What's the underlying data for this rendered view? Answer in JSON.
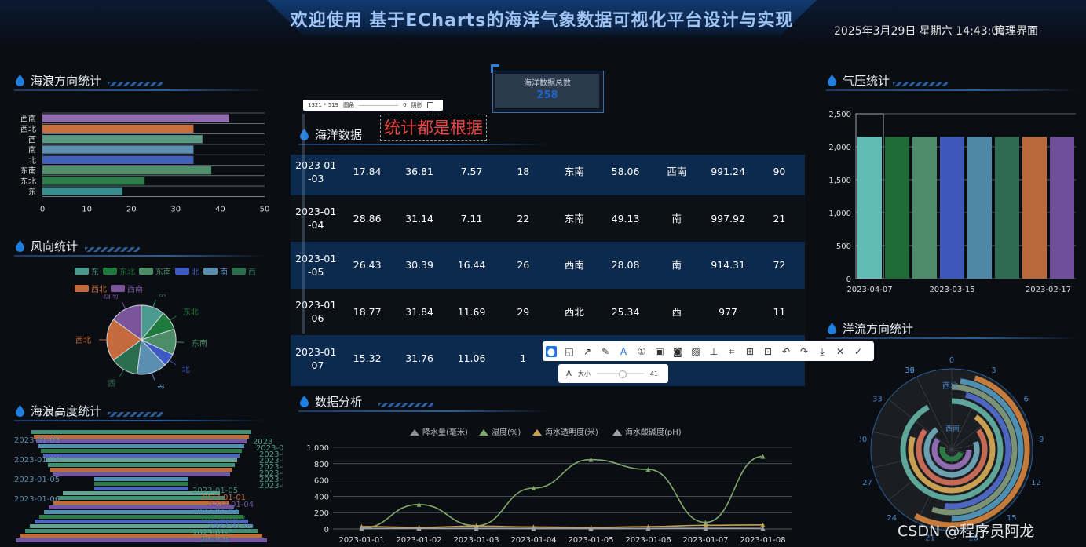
{
  "header": {
    "title": "欢迎使用 基于ECharts的海洋气象数据可视化平台设计与实现",
    "datetime": "2025年3月29日 星期六 14:43:00",
    "admin_link": "管理界面"
  },
  "panels": {
    "wave_direction": "海浪方向统计",
    "wind_direction": "风向统计",
    "wave_height": "海浪高度统计",
    "ocean_data": "海洋数据",
    "analysis": "数据分析",
    "pressure": "气压统计",
    "current_direction": "洋流方向统计"
  },
  "total": {
    "label": "海洋数据总数",
    "value": "258"
  },
  "wave_direction_chart": {
    "type": "bar",
    "orientation": "horizontal",
    "categories": [
      "西南",
      "西北",
      "西",
      "南",
      "北",
      "东南",
      "东北",
      "东"
    ],
    "values": [
      42,
      34,
      36,
      34,
      34,
      38,
      23,
      18
    ],
    "colors": [
      "#8f6bb0",
      "#c96e3f",
      "#5a9a84",
      "#5d8fb0",
      "#4461b8",
      "#4f8f6a",
      "#2e7d4a",
      "#3a8d8e"
    ],
    "xticks": [
      "0",
      "10",
      "20",
      "30",
      "40",
      "50"
    ],
    "xlim": [
      0,
      50
    ]
  },
  "wind_direction_chart": {
    "type": "pie",
    "legend": [
      "东",
      "东北",
      "东南",
      "北",
      "南",
      "西",
      "西北",
      "西南"
    ],
    "colors": [
      "#4b9a90",
      "#1f7a3d",
      "#4c8c66",
      "#3c5bc4",
      "#5b8fb2",
      "#2a6e4e",
      "#c46a3c",
      "#7a559c"
    ],
    "values": [
      11,
      9,
      12,
      6,
      14,
      13,
      20,
      15
    ]
  },
  "wave_height_labels": {
    "left": [
      "2023-01-03",
      "2023-01-04",
      "2023-01-05",
      "2023-01-06"
    ],
    "center": [
      "2023-01-05",
      "2023-01-01",
      "2023-01-04",
      "2023-01-03",
      "2023-01-07",
      "2023-01-06",
      "2023-01-0",
      "2023-0"
    ],
    "right": [
      "2023",
      "2023-0",
      "2023-0",
      "2023-01",
      "2023-01",
      "2023-01",
      "2023-01-",
      "2023-01-"
    ]
  },
  "ocean_table": {
    "rows": [
      [
        "2023-01\n-03",
        "17.84",
        "36.81",
        "7.57",
        "18",
        "东南",
        "58.06",
        "西南",
        "991.24",
        "90"
      ],
      [
        "2023-01\n-04",
        "28.86",
        "31.14",
        "7.11",
        "22",
        "东南",
        "49.13",
        "南",
        "997.92",
        "21"
      ],
      [
        "2023-01\n-05",
        "26.43",
        "30.39",
        "16.44",
        "26",
        "西南",
        "28.08",
        "南",
        "914.31",
        "72"
      ],
      [
        "2023-01\n-06",
        "18.77",
        "31.84",
        "11.69",
        "29",
        "西北",
        "25.34",
        "西",
        "977",
        "11"
      ],
      [
        "2023-01\n-07",
        "15.32",
        "31.76",
        "11.06",
        "1",
        "",
        "",
        "",
        "",
        ""
      ]
    ]
  },
  "analysis_chart": {
    "type": "line",
    "legend": [
      "降水量(毫米)",
      "湿度(%)",
      "海水透明度(米)",
      "海水酸碱度(pH)"
    ],
    "categories": [
      "2023-01-01",
      "2023-01-02",
      "2023-01-03",
      "2023-01-04",
      "2023-01-05",
      "2023-01-06",
      "2023-01-07",
      "2023-01-08"
    ],
    "series": [
      {
        "name": "降水量(毫米)",
        "color": "#8a8f99",
        "values": [
          5,
          8,
          6,
          4,
          3,
          5,
          7,
          6
        ]
      },
      {
        "name": "湿度(%)",
        "color": "#7fa86a",
        "values": [
          10,
          300,
          40,
          500,
          850,
          730,
          80,
          890
        ]
      },
      {
        "name": "海水透明度(米)",
        "color": "#c9a052",
        "values": [
          30,
          20,
          35,
          25,
          20,
          28,
          45,
          50
        ]
      },
      {
        "name": "海水酸碱度(pH)",
        "color": "#9aa0a8",
        "values": [
          7,
          8,
          7,
          8,
          8,
          7,
          8,
          7
        ]
      }
    ],
    "yticks": [
      "1,000",
      "800",
      "600",
      "400",
      "200",
      "0"
    ],
    "ylim": [
      0,
      1000
    ]
  },
  "pressure_chart": {
    "type": "bar",
    "values": [
      2150,
      2150,
      2150,
      2150,
      2150,
      2150,
      2150,
      2150
    ],
    "colors": [
      "#5fbdb6",
      "#1e6b38",
      "#4f8a6a",
      "#3d58b8",
      "#4f88a6",
      "#2f6a52",
      "#b8683c",
      "#6f4e9a"
    ],
    "yticks": [
      "2,500",
      "2,000",
      "1,500",
      "1,000",
      "500",
      "0"
    ],
    "xlabels": [
      "2023-04-07",
      "2023-03-15",
      "2023-02-17"
    ],
    "ylim": [
      0,
      2500
    ]
  },
  "current_chart": {
    "angle_labels": [
      "39",
      "0",
      "3",
      "6",
      "9",
      "12",
      "15",
      "18",
      "21",
      "24",
      "27",
      "30",
      "33",
      "36"
    ],
    "category_labels": [
      "西北",
      "西南"
    ]
  },
  "snip": {
    "size": "1321 * 519",
    "round_label": "圆角",
    "round_value": "0",
    "shadow_label": "阴影",
    "annotation": "统计都是根据",
    "size_label": "大小",
    "size_value": "41",
    "font_icon": "A",
    "tools": [
      "drop-icon",
      "shape-icon",
      "arrow-icon",
      "pen-icon",
      "text-icon",
      "number-icon",
      "mosaic-icon",
      "blur-icon",
      "hatch-icon",
      "pin-icon",
      "ocr-icon",
      "translate-icon",
      "screenshot-icon",
      "undo-icon",
      "redo-icon",
      "download-icon",
      "close-icon",
      "confirm-icon"
    ]
  },
  "watermark": "CSDN @程序员阿龙"
}
